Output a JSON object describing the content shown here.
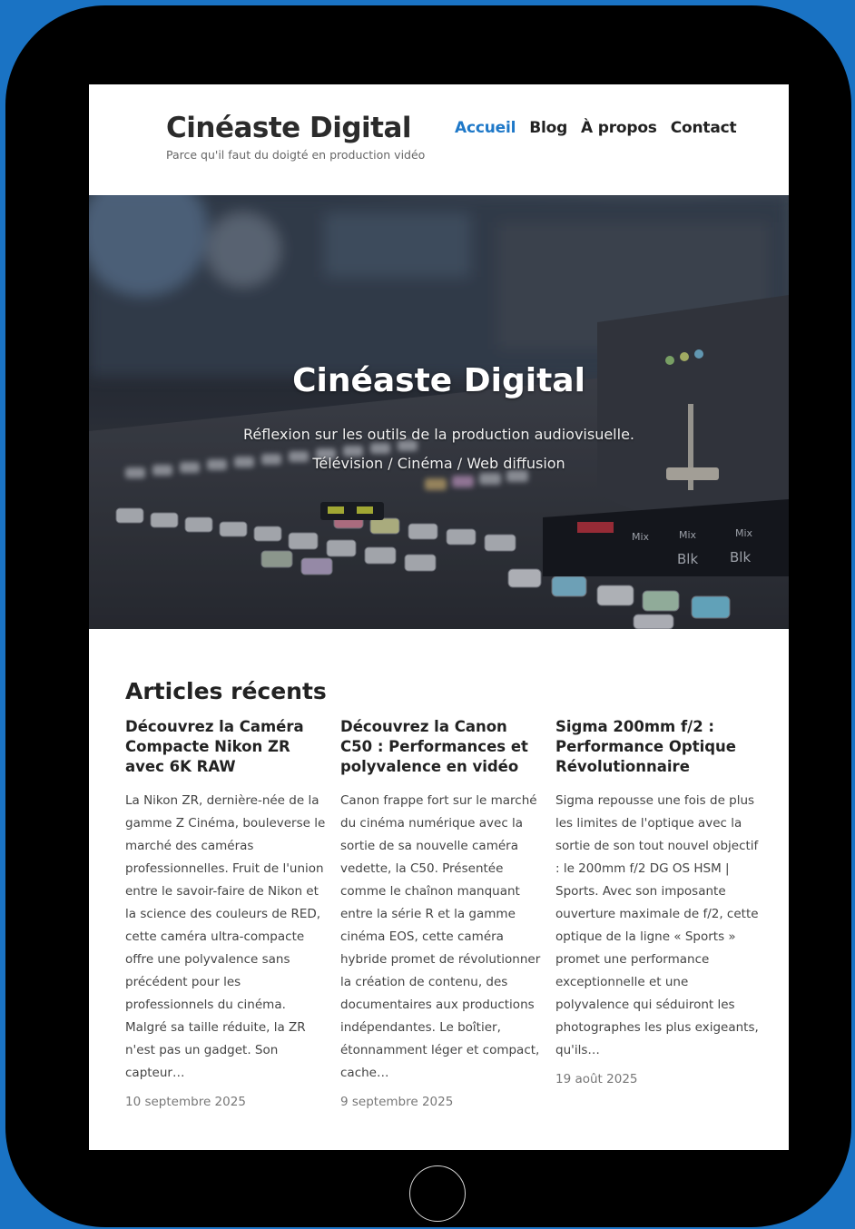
{
  "header": {
    "site_title": "Cinéaste Digital",
    "tagline": "Parce qu'il faut du doigté en production vidéo",
    "nav": [
      "Accueil",
      "Blog",
      "À propos",
      "Contact"
    ],
    "active_nav": "Accueil"
  },
  "hero": {
    "title": "Cinéaste Digital",
    "line1": "Réflexion sur les outils de la production audiovisuelle.",
    "line2": "Télévision / Cinéma / Web diffusion"
  },
  "articles_section": {
    "title": "Articles récents",
    "articles": [
      {
        "title": "Découvrez la Caméra Compacte Nikon ZR avec 6K RAW",
        "excerpt": "La Nikon ZR, dernière-née de la gamme Z Cinéma, bouleverse le marché des caméras professionnelles. Fruit de l'union entre le savoir-faire de Nikon et la science des couleurs de RED, cette caméra ultra-compacte offre une polyvalence sans précédent pour les professionnels du cinéma. Malgré sa taille réduite, la ZR n'est pas un gadget. Son capteur…",
        "date": "10 septembre 2025"
      },
      {
        "title": "Découvrez la Canon C50 : Performances et polyvalence en vidéo",
        "excerpt": "Canon frappe fort sur le marché du cinéma numérique avec la sortie de sa nouvelle caméra vedette, la C50. Présentée comme le chaînon manquant entre la série R et la gamme cinéma EOS, cette caméra hybride promet de révolutionner la création de contenu, des documentaires aux productions indépendantes. Le boîtier, étonnamment léger et compact, cache…",
        "date": "9 septembre 2025"
      },
      {
        "title": "Sigma 200mm f/2 : Performance Optique Révolutionnaire",
        "excerpt": "Sigma repousse une fois de plus les limites de l'optique avec la sortie de son tout nouvel objectif : le 200mm f/2 DG OS HSM | Sports. Avec son imposante ouverture maximale de f/2, cette optique de la ligne « Sports » promet une performance exceptionnelle et une polyvalence qui séduiront les photographes les plus exigeants, qu'ils…",
        "date": "19 août 2025"
      }
    ]
  },
  "colors": {
    "background": "#1a73c4",
    "accent": "#1e78c8",
    "text": "#222222"
  }
}
